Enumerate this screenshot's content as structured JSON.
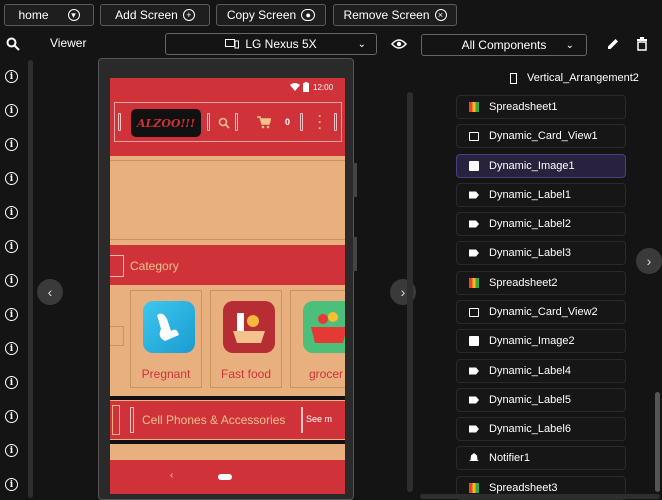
{
  "toolbar": {
    "screen_select": "home",
    "add_screen": "Add Screen",
    "copy_screen": "Copy Screen",
    "remove_screen": "Remove Screen"
  },
  "viewer": {
    "label": "Viewer",
    "device": "LG Nexus 5X",
    "components_filter": "All Components"
  },
  "phone": {
    "time": "12:00",
    "logo_text": "ALZOO!!!",
    "cart_count": "0",
    "category_label": "Category",
    "categories": [
      "Pregnant",
      "Fast food",
      "grocer"
    ],
    "cell_label": "Cell Phones & Accessories",
    "see_more": "See m"
  },
  "components": [
    {
      "name": "Vertical_Arrangement2",
      "icon": "vert"
    },
    {
      "name": "Spreadsheet1",
      "icon": "sheet"
    },
    {
      "name": "Dynamic_Card_View1",
      "icon": "card"
    },
    {
      "name": "Dynamic_Image1",
      "icon": "image",
      "selected": true
    },
    {
      "name": "Dynamic_Label1",
      "icon": "label"
    },
    {
      "name": "Dynamic_Label2",
      "icon": "label"
    },
    {
      "name": "Dynamic_Label3",
      "icon": "label"
    },
    {
      "name": "Spreadsheet2",
      "icon": "sheet"
    },
    {
      "name": "Dynamic_Card_View2",
      "icon": "card"
    },
    {
      "name": "Dynamic_Image2",
      "icon": "image"
    },
    {
      "name": "Dynamic_Label4",
      "icon": "label"
    },
    {
      "name": "Dynamic_Label5",
      "icon": "label"
    },
    {
      "name": "Dynamic_Label6",
      "icon": "label"
    },
    {
      "name": "Notifier1",
      "icon": "bell"
    },
    {
      "name": "Spreadsheet3",
      "icon": "sheet"
    }
  ],
  "colors": {
    "app_red": "#d0323a",
    "app_tan": "#e8b07e",
    "selected_bg": "#28223f"
  }
}
